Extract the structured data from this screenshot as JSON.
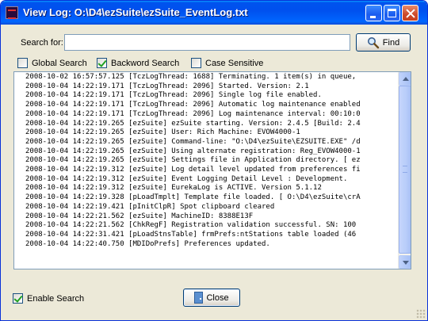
{
  "window": {
    "title": "View Log: O:\\D4\\ezSuite\\ezSuite_EventLog.txt",
    "accent": "#0053ee"
  },
  "search": {
    "label": "Search for:",
    "value": "",
    "find_label": "Find"
  },
  "options": {
    "global_search": {
      "label": "Global Search",
      "checked": false
    },
    "backword_search": {
      "label": "Backword Search",
      "checked": true
    },
    "case_sensitive": {
      "label": "Case Sensitive",
      "checked": false
    }
  },
  "log": {
    "lines": [
      "2008-10-02 16:57:57.125 [TczLogThread: 1688] Terminating. 1 item(s) in queue,",
      "2008-10-04 14:22:19.171 [TczLogThread: 2096] Started. Version: 2.1",
      "2008-10-04 14:22:19.171 [TczLogThread: 2096] Single log file enabled.",
      "2008-10-04 14:22:19.171 [TczLogThread: 2096] Automatic log maintenance enabled",
      "2008-10-04 14:22:19.171 [TczLogThread: 2096] Log maintenance interval: 00:10:0",
      "2008-10-04 14:22:19.265 [ezSuite] ezSuite starting. Version: 2.4.5 [Build: 2.4",
      "2008-10-04 14:22:19.265 [ezSuite] User: Rich Machine: EVOW4000-1",
      "2008-10-04 14:22:19.265 [ezSuite] Command-line: \"O:\\D4\\ezSuite\\EZSUITE.EXE\" /d",
      "2008-10-04 14:22:19.265 [ezSuite] Using alternate registration: Reg_EVOW4000-1",
      "2008-10-04 14:22:19.265 [ezSuite] Settings file in Application directory. [ ez",
      "2008-10-04 14:22:19.312 [ezSuite] Log detail level updated from preferences fi",
      "2008-10-04 14:22:19.312 [ezSuite] Event Logging Detail Level : Development.",
      "2008-10-04 14:22:19.312 [ezSuite] EurekaLog is ACTIVE. Version 5.1.12",
      "2008-10-04 14:22:19.328 [pLoadTmplt] Template file loaded. [ O:\\D4\\ezSuite\\crA",
      "2008-10-04 14:22:19.421 [pInitClpR] Spot clipboard cleared",
      "2008-10-04 14:22:21.562 [ezSuite] MachineID: 8388E13F",
      "2008-10-04 14:22:21.562 [ChkRegF] Registration validation successful. SN: 100",
      "2008-10-04 14:22:31.421 [pLoadStnsTable] frmPrefs:ntStations table loaded (46",
      "2008-10-04 14:22:40.750 [MDIDoPrefs] Preferences updated."
    ]
  },
  "footer": {
    "enable_search": {
      "label": "Enable Search",
      "checked": true
    },
    "close_label": "Close"
  }
}
